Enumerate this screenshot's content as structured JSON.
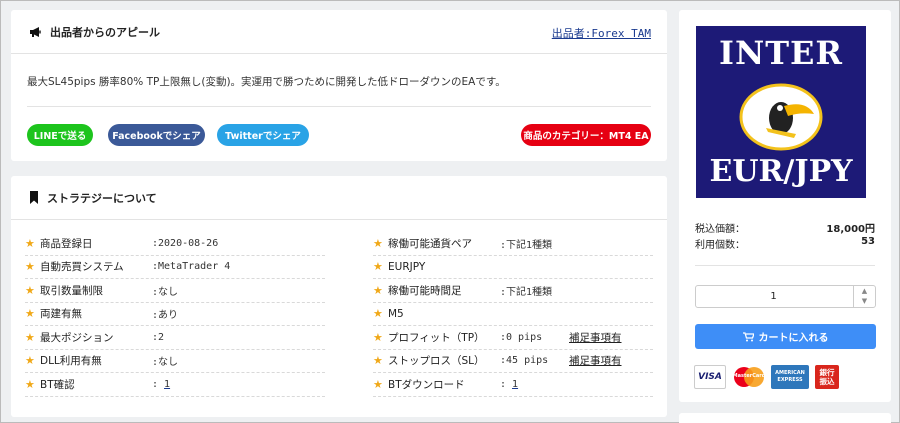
{
  "appeal": {
    "title": "出品者からのアピール",
    "seller_link": "出品者:Forex TAM",
    "description": "最大SL45pips 勝率80% TP上限無し(変動)。実運用で勝つために開発した低ドローダウンのEAです。",
    "share_line": "LINEで送る",
    "share_facebook": "Facebookでシェア",
    "share_twitter": "Twitterでシェア",
    "category": "商品のカテゴリー：MT4 EA"
  },
  "strategy": {
    "title": "ストラテジーについて",
    "left": [
      {
        "label": "商品登録日",
        "value": ":2020-08-26"
      },
      {
        "label": "自動売買システム",
        "value": ":MetaTrader 4"
      },
      {
        "label": "取引数量制限",
        "value": ":なし"
      },
      {
        "label": "両建有無",
        "value": ":あり"
      },
      {
        "label": "最大ポジション",
        "value": ":2"
      },
      {
        "label": "DLL利用有無",
        "value": ":なし"
      },
      {
        "label": "BT確認",
        "value_prefix": ":",
        "value_link": "1"
      }
    ],
    "right": [
      {
        "label": "稼働可能通貨ペア",
        "value": ":下記1種類"
      },
      {
        "label": "EURJPY"
      },
      {
        "label": "稼働可能時間足",
        "value": ":下記1種類"
      },
      {
        "label": "M5"
      },
      {
        "label": "プロフィット（TP）",
        "value": ":0 pips",
        "note": "補足事項有"
      },
      {
        "label": "ストップロス（SL）",
        "value": ":45 pips",
        "note": "補足事項有"
      },
      {
        "label": "BTダウンロード",
        "value_prefix": ":",
        "value_link": "1"
      }
    ]
  },
  "product": {
    "logo_top": "INTER",
    "logo_bottom": "EUR/JPY",
    "price_label": "税込価額：",
    "price_value": "18,000円",
    "users_label": "利用個数：",
    "users_value": "53",
    "quantity": "1",
    "cart_button": "カートに入れる",
    "payments": {
      "visa": "VISA",
      "mastercard": "MasterCard",
      "amex_line1": "AMERICAN",
      "amex_line2": "EXPRESS",
      "bank_line1": "銀行",
      "bank_line2": "振込"
    }
  },
  "colors": {
    "line": "#1dc41d",
    "facebook": "#3b5998",
    "twitter": "#29a3e6",
    "category": "#e60012",
    "star": "#f0a818",
    "cart": "#3e8ef7",
    "link": "#1a3a8f"
  }
}
